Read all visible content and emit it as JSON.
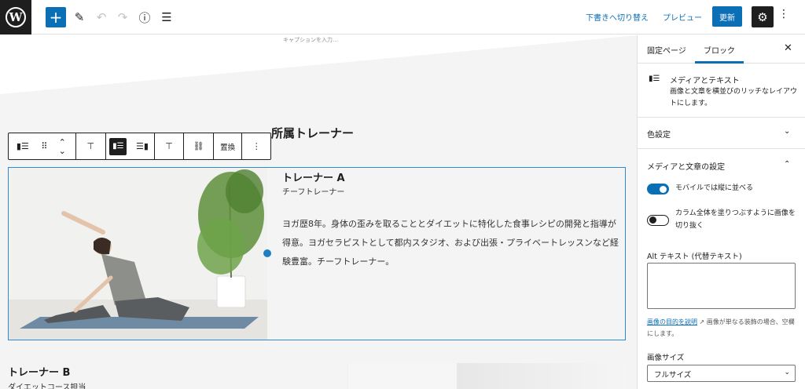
{
  "topbar": {
    "logo": "W",
    "add_icon": "+",
    "edit_icon": "✎",
    "undo_icon": "↶",
    "redo_icon": "↷",
    "info_icon": "ⓘ",
    "list_view_icon": "☰",
    "draft_switch": "下書きへ切り替え",
    "preview": "プレビュー",
    "update": "更新",
    "settings_icon": "⚙",
    "more_icon": "⋮"
  },
  "canvas": {
    "caption_placeholder": "キャプションを入力…",
    "section_heading": "所属トレーナー",
    "toolbar": {
      "block_icon": "▮☰",
      "drag_icon": "⠿",
      "move_up": "⌃",
      "move_down": "⌄",
      "align_icon": "⊤",
      "media_left_icon": "▮☰",
      "media_right_icon": "☰▮",
      "vertical_align_icon": "⊤",
      "link_icon": "⛓",
      "replace": "置換",
      "more_icon": "⋮"
    },
    "trainer_a": {
      "name": "トレーナー A",
      "role": "チーフトレーナー",
      "bio": "ヨガ歴8年。身体の歪みを取ることとダイエットに特化した食事レシピの開発と指導が得意。ヨガセラピストとして都内スタジオ、および出張・プライベートレッスンなど経験豊富。チーフトレーナー。"
    },
    "trainer_b": {
      "name": "トレーナー B",
      "role": "ダイエットコース担当"
    }
  },
  "sidebar": {
    "tab_page": "固定ページ",
    "tab_block": "ブロック",
    "close_icon": "✕",
    "block_title": "メディアとテキスト",
    "block_desc": "画像と文章を横並びのリッチなレイアウトにします。",
    "color_panel": "色設定",
    "media_panel": "メディアと文章の設定",
    "chevron_down": "⌄",
    "chevron_up": "⌃",
    "toggle_stack": "モバイルでは縦に並べる",
    "toggle_stack_on": true,
    "toggle_crop": "カラム全体を塗りつぶすように画像を切り抜く",
    "toggle_crop_on": false,
    "alt_label": "Alt テキスト (代替テキスト)",
    "alt_link": "画像の目的を説明",
    "alt_help": "画像が単なる装飾の場合、空欄にします。",
    "external_icon": "↗",
    "size_label": "画像サイズ",
    "size_value": "フルサイズ",
    "select_caret": "⌄"
  }
}
